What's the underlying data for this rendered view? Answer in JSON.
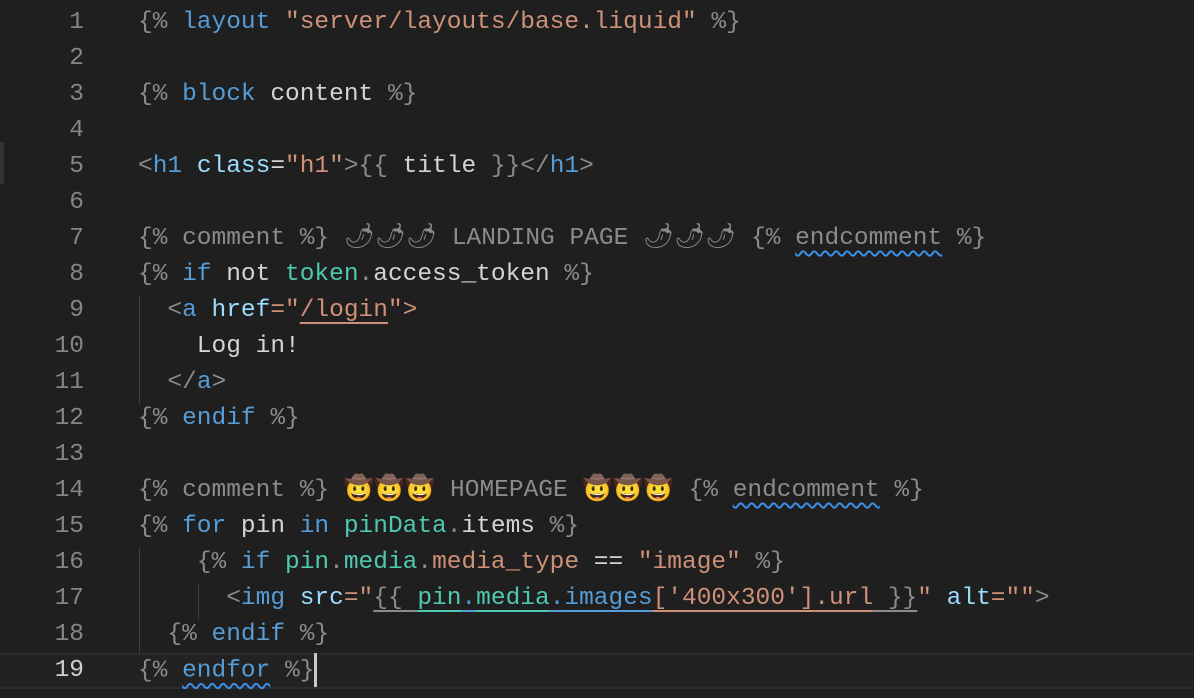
{
  "editor": {
    "current_line": 19,
    "lines": [
      {
        "n": "1",
        "tokens": [
          [
            "{% ",
            "d"
          ],
          [
            "layout",
            "k"
          ],
          [
            " ",
            "p"
          ],
          [
            "\"server/layouts/base.liquid\"",
            "s"
          ],
          [
            " %}",
            "d"
          ]
        ]
      },
      {
        "n": "2",
        "tokens": []
      },
      {
        "n": "3",
        "tokens": [
          [
            "{% ",
            "d"
          ],
          [
            "block",
            "k"
          ],
          [
            " content",
            "p"
          ],
          [
            " %}",
            "d"
          ]
        ]
      },
      {
        "n": "4",
        "tokens": []
      },
      {
        "n": "5",
        "tokens": [
          [
            "<",
            "d"
          ],
          [
            "h1",
            "k"
          ],
          [
            " ",
            "p"
          ],
          [
            "class",
            "a"
          ],
          [
            "=",
            "p"
          ],
          [
            "\"h1\"",
            "s"
          ],
          [
            ">",
            "d"
          ],
          [
            "{{ ",
            "d"
          ],
          [
            "title",
            "p"
          ],
          [
            " }}",
            "d"
          ],
          [
            "</",
            "d"
          ],
          [
            "h1",
            "k"
          ],
          [
            ">",
            "d"
          ]
        ]
      },
      {
        "n": "6",
        "tokens": []
      },
      {
        "n": "7",
        "tokens": [
          [
            "{% comment %} 🌶🌶🌶 LANDING PAGE 🌶🌶🌶 {% ",
            "c"
          ],
          [
            "endcomment",
            "c sq"
          ],
          [
            " %}",
            "c"
          ]
        ]
      },
      {
        "n": "8",
        "tokens": [
          [
            "{% ",
            "d"
          ],
          [
            "if",
            "k"
          ],
          [
            " not ",
            "p"
          ],
          [
            "token",
            "v"
          ],
          [
            ".",
            "d"
          ],
          [
            "access_token",
            "p"
          ],
          [
            " %}",
            "d"
          ]
        ]
      },
      {
        "n": "9",
        "tokens": [
          [
            "  <",
            "d"
          ],
          [
            "a",
            "k"
          ],
          [
            " ",
            "p"
          ],
          [
            "href",
            "a"
          ],
          [
            "=\"",
            "s"
          ],
          [
            "/login",
            "s ul"
          ],
          [
            "\">",
            "s"
          ]
        ]
      },
      {
        "n": "10",
        "tokens": [
          [
            "    Log in!",
            "p"
          ]
        ]
      },
      {
        "n": "11",
        "tokens": [
          [
            "  </",
            "d"
          ],
          [
            "a",
            "k"
          ],
          [
            ">",
            "d"
          ]
        ]
      },
      {
        "n": "12",
        "tokens": [
          [
            "{% ",
            "d"
          ],
          [
            "endif",
            "k"
          ],
          [
            " %}",
            "d"
          ]
        ]
      },
      {
        "n": "13",
        "tokens": []
      },
      {
        "n": "14",
        "tokens": [
          [
            "{% comment %} 🤠🤠🤠 HOMEPAGE 🤠🤠🤠 {% ",
            "c"
          ],
          [
            "endcomment",
            "c sq"
          ],
          [
            " %}",
            "c"
          ]
        ]
      },
      {
        "n": "15",
        "tokens": [
          [
            "{% ",
            "d"
          ],
          [
            "for",
            "k"
          ],
          [
            " pin ",
            "p"
          ],
          [
            "in",
            "k"
          ],
          [
            " ",
            "p"
          ],
          [
            "pinData",
            "v"
          ],
          [
            ".",
            "d"
          ],
          [
            "items",
            "p"
          ],
          [
            " %}",
            "d"
          ]
        ]
      },
      {
        "n": "16",
        "tokens": [
          [
            "    {% ",
            "d"
          ],
          [
            "if",
            "k"
          ],
          [
            " ",
            "p"
          ],
          [
            "pin",
            "v"
          ],
          [
            ".",
            "d"
          ],
          [
            "media",
            "v"
          ],
          [
            ".",
            "d"
          ],
          [
            "media_type",
            "s"
          ],
          [
            " == ",
            "p"
          ],
          [
            "\"image\"",
            "s"
          ],
          [
            " %}",
            "d"
          ]
        ]
      },
      {
        "n": "17",
        "tokens": [
          [
            "      <",
            "d"
          ],
          [
            "img",
            "k"
          ],
          [
            " ",
            "p"
          ],
          [
            "src",
            "a"
          ],
          [
            "=\"",
            "s"
          ],
          [
            "{{ ",
            "d ul"
          ],
          [
            "pin",
            "v ul"
          ],
          [
            ".",
            "k ul"
          ],
          [
            "media",
            "v ul"
          ],
          [
            ".",
            "k ul"
          ],
          [
            "images",
            "k ul"
          ],
          [
            "['400x300']",
            "s ul"
          ],
          [
            ".url",
            "s ul"
          ],
          [
            " }}",
            "d ul"
          ],
          [
            "\" ",
            "s"
          ],
          [
            "alt",
            "a"
          ],
          [
            "=\"\"",
            "s"
          ],
          [
            ">",
            "d"
          ]
        ]
      },
      {
        "n": "18",
        "tokens": [
          [
            "  {% ",
            "d"
          ],
          [
            "endif",
            "k"
          ],
          [
            " %}",
            "d"
          ]
        ]
      },
      {
        "n": "19",
        "tokens": [
          [
            "{% ",
            "d"
          ],
          [
            "endfor",
            "k sq"
          ],
          [
            " %}",
            "d"
          ]
        ]
      }
    ]
  }
}
